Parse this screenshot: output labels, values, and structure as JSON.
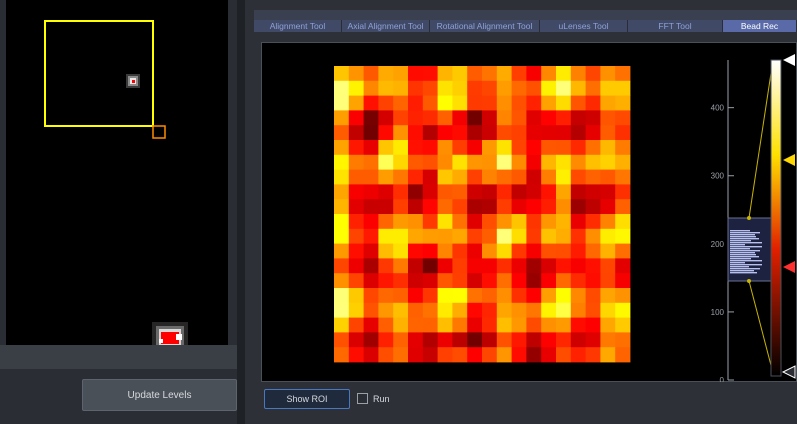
{
  "tabs": [
    {
      "label": "Alignment Tool",
      "active": false
    },
    {
      "label": "Axial Alignment Tool",
      "active": false
    },
    {
      "label": "Rotational Alignment Tool",
      "active": false
    },
    {
      "label": "uLenses Tool",
      "active": false
    },
    {
      "label": "FFT Tool",
      "active": false
    },
    {
      "label": "Bead Rec",
      "active": true
    }
  ],
  "left_panel": {
    "update_levels_label": "Update Levels",
    "roi_color": "#ffff00",
    "roi_handle_color": "#ff8c00"
  },
  "bottom_bar": {
    "show_roi_label": "Show ROI",
    "run_label": "Run",
    "run_checked": false
  },
  "histogram": {
    "tick_labels": [
      "400",
      "300",
      "200",
      "100",
      "0"
    ],
    "tick_values": [
      400,
      300,
      200,
      100,
      0
    ],
    "range": [
      0,
      470
    ],
    "level_markers": {
      "top_color": "#ffffff",
      "mid_color": "#ffd700",
      "low_color": "#ff3030",
      "bottom_color": "#ffffff"
    }
  },
  "colormap": "hot"
}
